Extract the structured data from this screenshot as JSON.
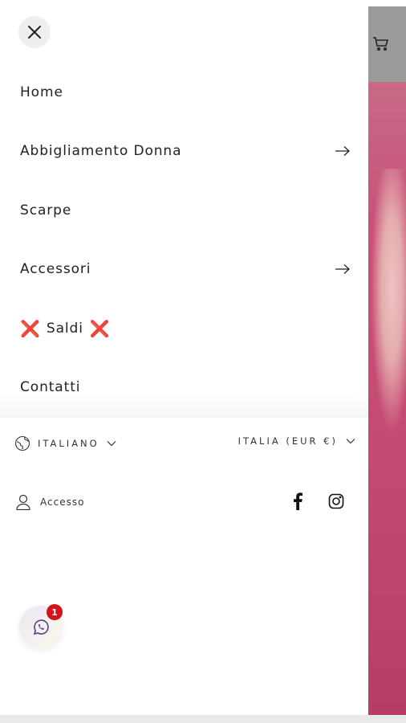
{
  "menu": {
    "close_label": "×",
    "items": [
      {
        "label": "Home",
        "has_submenu": false
      },
      {
        "label": "Abbigliamento Donna",
        "has_submenu": true
      },
      {
        "label": "Scarpe",
        "has_submenu": false
      },
      {
        "label": "Accessori",
        "has_submenu": true
      },
      {
        "label": "Saldi",
        "has_submenu": false,
        "prefix": "❌",
        "suffix": "❌"
      },
      {
        "label": "Contatti",
        "has_submenu": false
      }
    ]
  },
  "utility": {
    "language": "ITALIANO",
    "country": "ITALIA (EUR €)",
    "account": "Accesso",
    "social": [
      "facebook-icon",
      "instagram-icon"
    ]
  },
  "whatsapp": {
    "badge_count": "1"
  },
  "colors": {
    "sale_x": "#e0151d",
    "badge": "#d6131c",
    "close_bg": "#efefef"
  }
}
